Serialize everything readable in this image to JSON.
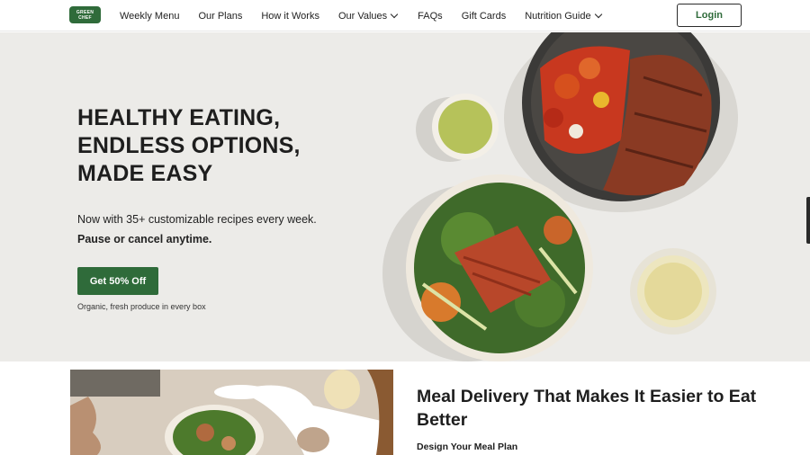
{
  "brand": {
    "logo_line1": "GREEN",
    "logo_line2": "CHEF",
    "color": "#2f6b3a"
  },
  "nav": {
    "items": [
      {
        "label": "Weekly Menu",
        "dropdown": false
      },
      {
        "label": "Our Plans",
        "dropdown": false
      },
      {
        "label": "How it Works",
        "dropdown": false
      },
      {
        "label": "Our Values",
        "dropdown": true
      },
      {
        "label": "FAQs",
        "dropdown": false
      },
      {
        "label": "Gift Cards",
        "dropdown": false
      },
      {
        "label": "Nutrition Guide",
        "dropdown": true
      }
    ],
    "login_label": "Login"
  },
  "hero": {
    "title_line1": "HEALTHY EATING,",
    "title_line2": "ENDLESS OPTIONS,",
    "title_line3": "MADE EASY",
    "subtitle": "Now with 35+ customizable recipes every week.",
    "subtitle_bold": "Pause or cancel anytime.",
    "cta_label": "Get 50% Off",
    "note": "Organic, fresh produce in every box"
  },
  "section": {
    "title": "Meal Delivery That Makes It Easier to Eat Better",
    "subtitle": "Design Your Meal Plan"
  },
  "icons": [
    "chevron-down-icon"
  ]
}
